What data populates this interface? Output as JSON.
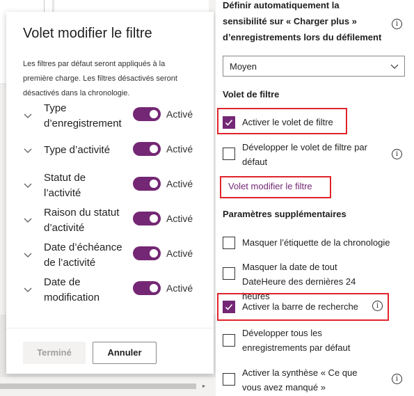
{
  "flyout": {
    "title": "Volet modifier le filtre",
    "description": "Les filtres par défaut seront appliqués à la première charge. Les filtres désactivés seront désactivés dans la chronologie.",
    "filters": [
      {
        "label": "Type d’enregistrement",
        "state": "Activé"
      },
      {
        "label": "Type d’activité",
        "state": "Activé"
      },
      {
        "label": "Statut de l’activité",
        "state": "Activé"
      },
      {
        "label": "Raison du statut d’activité",
        "state": "Activé"
      },
      {
        "label": "Date d’échéance de l’activité",
        "state": "Activé"
      },
      {
        "label": "Date de modification",
        "state": "Activé"
      }
    ],
    "done_label": "Terminé",
    "cancel_label": "Annuler"
  },
  "properties": {
    "auto_sensitivity_label": "Définir automatiquement la sensibilité sur « Charger plus » d’enregistrements lors du défilement",
    "sensitivity_value": "Moyen",
    "filter_section": "Volet de filtre",
    "enable_filter_pane": "Activer le volet de filtre",
    "expand_filter_pane": "Développer le volet de filtre par défaut",
    "edit_filter_pane_button": "Volet modifier le filtre",
    "additional_section": "Paramètres supplémentaires",
    "hide_timeline_label": "Masquer l’étiquette de la chronologie",
    "hide_datetime": "Masquer la date de tout DateHeure des dernières 24 heures",
    "enable_search_bar": "Activer la barre de recherche",
    "expand_all_records": "Développer tous les enregistrements par défaut",
    "enable_summary": "Activer la synthèse « Ce que vous avez manqué »"
  },
  "colors": {
    "accent": "#742774",
    "highlight": "#e0232b"
  },
  "icons": {
    "info": "info-icon",
    "chevron": "chevron-down-icon",
    "check": "checkmark-icon"
  }
}
